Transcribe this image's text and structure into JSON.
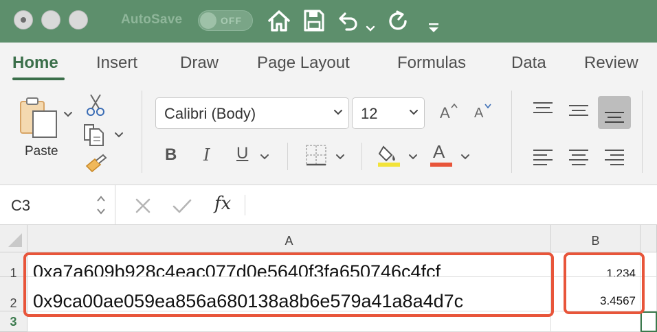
{
  "titlebar": {
    "autosave_label": "AutoSave",
    "autosave_state": "OFF",
    "icons": [
      "home-icon",
      "save-icon",
      "undo-icon",
      "redo-icon",
      "customize-toolbar-icon"
    ]
  },
  "ribbon_tabs": [
    "Home",
    "Insert",
    "Draw",
    "Page Layout",
    "Formulas",
    "Data",
    "Review"
  ],
  "active_tab": "Home",
  "ribbon": {
    "paste_label": "Paste",
    "font_name": "Calibri (Body)",
    "font_size": "12",
    "bold": "B",
    "italic": "I",
    "underline": "U",
    "grow_font": "A",
    "shrink_font": "A",
    "font_color_letter": "A",
    "highlight_color": "#f2e33a",
    "font_color": "#e8553a"
  },
  "formula_bar": {
    "name_box": "C3",
    "fx_label": "fx",
    "formula": ""
  },
  "sheet": {
    "columns": [
      "A",
      "B"
    ],
    "rows": [
      "1",
      "2",
      "3"
    ],
    "selected_row": "3",
    "cells": {
      "A1": "0xa7a609b928c4eac077d0e5640f3fa650746c4fcf",
      "A2": "0x9ca00ae059ea856a680138a8b6e579a41a8a4d7c",
      "B1": "1.234",
      "B2": "3.4567"
    }
  },
  "colors": {
    "titlebar": "#5d8f6c",
    "accent": "#3b6f4a",
    "highlight_box": "#e8553a"
  }
}
